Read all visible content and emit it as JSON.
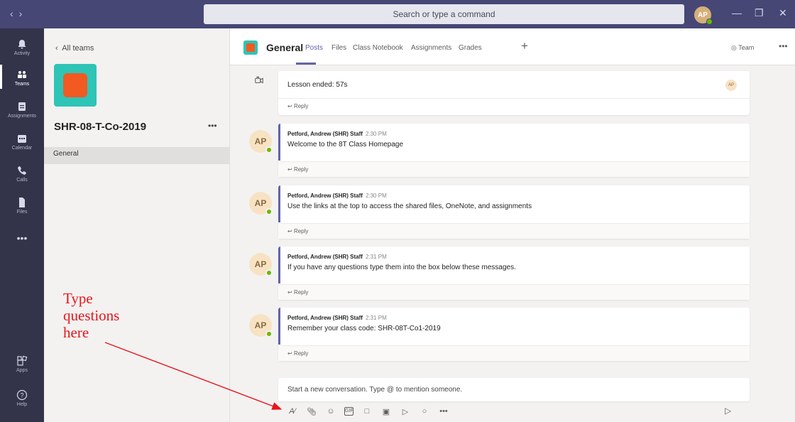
{
  "titlebar": {
    "search_placeholder": "Search or type a command",
    "avatar_initials": "AP"
  },
  "rail": {
    "items": [
      {
        "label": "Activity",
        "icon": "bell-icon"
      },
      {
        "label": "Teams",
        "icon": "teams-icon"
      },
      {
        "label": "Assignments",
        "icon": "assignments-icon"
      },
      {
        "label": "Calendar",
        "icon": "calendar-icon"
      },
      {
        "label": "Calls",
        "icon": "phone-icon"
      },
      {
        "label": "Files",
        "icon": "file-icon"
      },
      {
        "label": "Apps",
        "icon": "apps-icon"
      },
      {
        "label": "Help",
        "icon": "help-icon"
      }
    ]
  },
  "team": {
    "back_label": "All teams",
    "name": "SHR-08-T-Co-2019",
    "channel": "General"
  },
  "header": {
    "channel_name": "General",
    "tabs": [
      "Posts",
      "Files",
      "Class Notebook",
      "Assignments",
      "Grades"
    ],
    "team_label": "Team"
  },
  "conversation": {
    "lesson_text": "Lesson ended: 57s",
    "lesson_avatar": "AP",
    "reply_label": "Reply",
    "posts": [
      {
        "author": "Petford, Andrew (SHR) Staff",
        "time": "2:30 PM",
        "text": "Welcome to the 8T Class Homepage",
        "initials": "AP"
      },
      {
        "author": "Petford, Andrew (SHR) Staff",
        "time": "2:30 PM",
        "text": "Use the links at the top to access the shared files, OneNote, and assignments",
        "initials": "AP"
      },
      {
        "author": "Petford, Andrew (SHR) Staff",
        "time": "2:31 PM",
        "text": "If you have any questions type them into the box below these messages.",
        "initials": "AP"
      },
      {
        "author": "Petford, Andrew (SHR) Staff",
        "time": "2:31 PM",
        "text": "Remember your class code: SHR-08T-Co1-2019",
        "initials": "AP"
      }
    ],
    "compose_placeholder": "Start a new conversation. Type @ to mention someone."
  },
  "annotation": {
    "lines": [
      "Type",
      "questions",
      "here"
    ],
    "color": "#e8141b"
  },
  "colors": {
    "titlebar": "#464775",
    "rail": "#33344a",
    "accent": "#6264a7",
    "team_logo_bg": "#2ec4b6",
    "team_logo_fg": "#f25a22",
    "presence": "#6bb700"
  }
}
